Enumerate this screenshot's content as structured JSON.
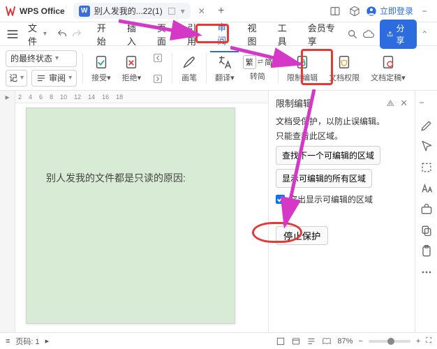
{
  "titlebar": {
    "appName": "WPS Office",
    "docTitle": "别人发我的...22(1)",
    "plus": "+",
    "login": "立即登录"
  },
  "menu": {
    "fileLabel": "文件",
    "items": [
      "开始",
      "插入",
      "页面",
      "引用",
      "审阅",
      "视图",
      "工具",
      "会员专享"
    ]
  },
  "share": "分享",
  "ribbon": {
    "statusDropdown": "的最终状态",
    "rec": "记",
    "review": "审阅",
    "accept": "接受",
    "reject": "拒绝",
    "brush": "画笔",
    "translate": "翻译",
    "fanjian": "繁",
    "zhuanjian": "转简",
    "restrictEdit": "限制编辑",
    "docPermission": "文档权限",
    "docFinal": "文档定稿"
  },
  "ruler": [
    "2",
    "4",
    "6",
    "8",
    "10",
    "12",
    "14",
    "16",
    "18"
  ],
  "page": {
    "text": "别人发我的文件都是只读的原因:"
  },
  "panel": {
    "title": "限制编辑",
    "line1": "文档受保护，以防止误编辑。",
    "line2": "只能查看此区域。",
    "btnFindNext": "查找下一个可编辑的区域",
    "btnShowAll": "显示可编辑的所有区域",
    "checkboxLabel": "突出显示可编辑的区域",
    "stopBtn": "停止保护"
  },
  "status": {
    "pageLabel": "页码: 1",
    "zoom": "87%"
  }
}
